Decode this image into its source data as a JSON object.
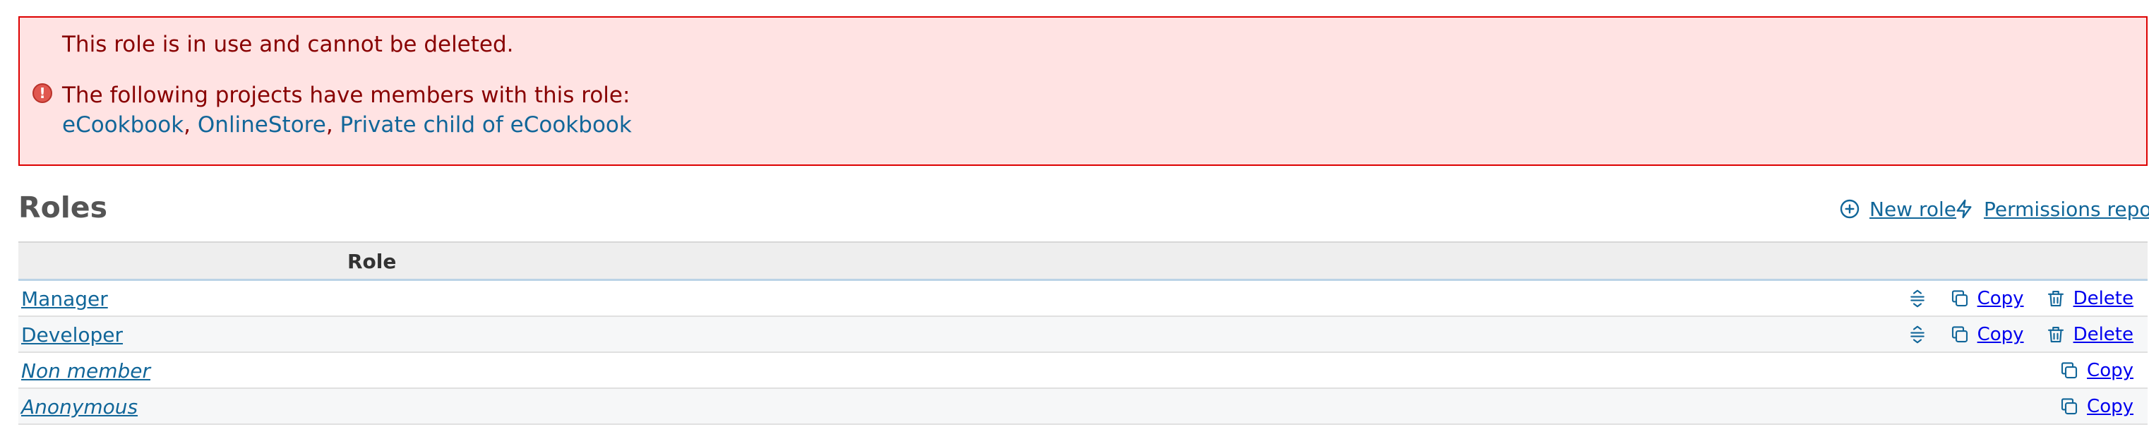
{
  "flash": {
    "message_line1": "This role is in use and cannot be deleted.",
    "message_line2": "The following projects have members with this role:",
    "projects": [
      "eCookbook",
      "OnlineStore",
      "Private child of eCookbook"
    ],
    "separator": ",",
    "icon": "error-icon",
    "icon_glyph": "!"
  },
  "page": {
    "title": "Roles",
    "new_role_label": "New role",
    "permissions_report_label": "Permissions report"
  },
  "table": {
    "column_header": "Role",
    "rows": [
      {
        "name": "Manager",
        "builtin": false,
        "actions": {
          "reorder": true,
          "copy": "Copy",
          "delete": "Delete"
        }
      },
      {
        "name": "Developer",
        "builtin": false,
        "actions": {
          "reorder": true,
          "copy": "Copy",
          "delete": "Delete"
        }
      },
      {
        "name": "Non member",
        "builtin": true,
        "actions": {
          "reorder": false,
          "copy": "Copy",
          "delete": null
        }
      },
      {
        "name": "Anonymous",
        "builtin": true,
        "actions": {
          "reorder": false,
          "copy": "Copy",
          "delete": null
        }
      }
    ]
  },
  "colors": {
    "link": "#116699",
    "flash_background": "#ffe3e3",
    "flash_border": "#dd0000",
    "flash_text": "#880000"
  }
}
